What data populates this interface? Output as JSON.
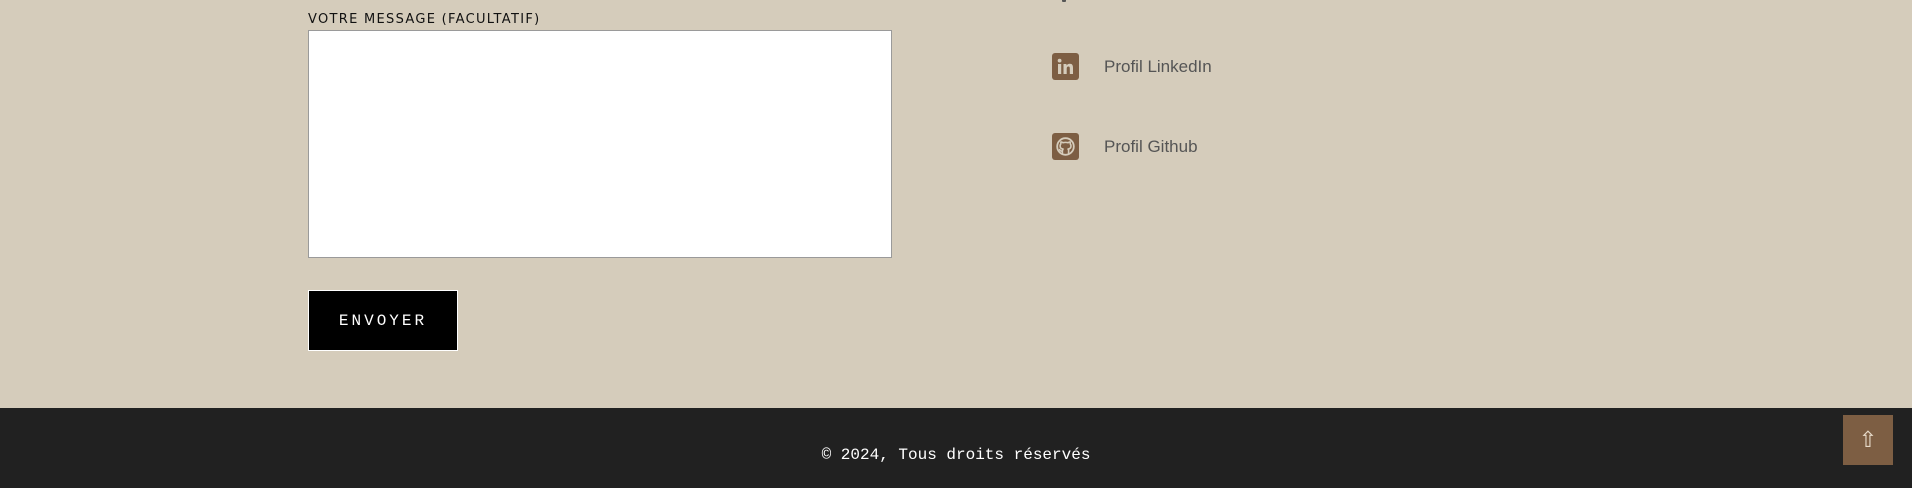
{
  "contact_form": {
    "message_label": "Votre message (facultatif)",
    "message_value": "",
    "submit_label": "ENVOYER"
  },
  "social": {
    "items": [
      {
        "icon": "linkedin-icon",
        "label": "Profil LinkedIn"
      },
      {
        "icon": "github-icon",
        "label": "Profil Github"
      }
    ],
    "icon_color": "#7d5e43"
  },
  "footer": {
    "copyright": "© 2024, Tous droits réservés"
  },
  "back_to_top": {
    "icon": "arrow-up-icon",
    "glyph": "⇧"
  },
  "colors": {
    "page_background": "#d5ccbb",
    "footer_background": "#212121",
    "accent": "#7d5e43",
    "button_background": "#000000"
  }
}
